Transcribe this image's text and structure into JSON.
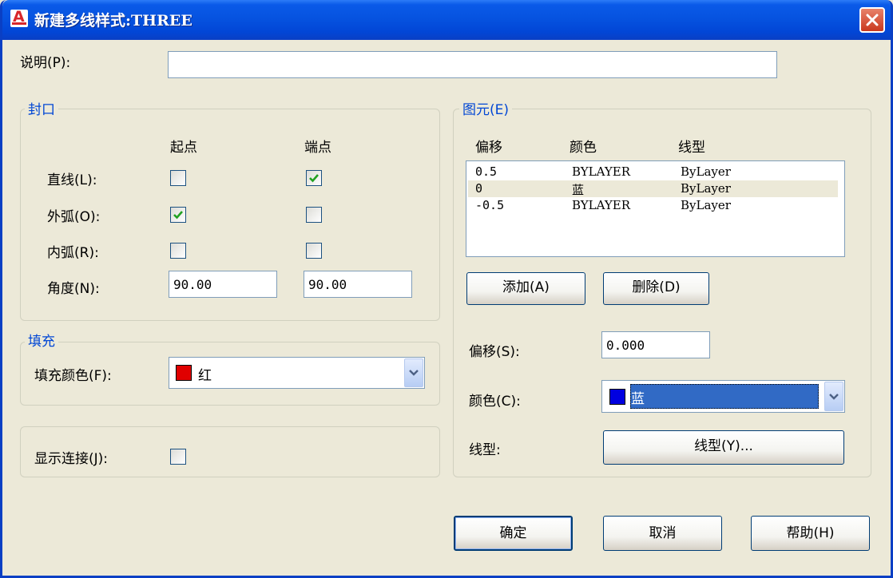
{
  "window": {
    "title": "新建多线样式:THREE"
  },
  "description": {
    "label": "说明(P):",
    "value": ""
  },
  "caps": {
    "title": "封口",
    "col_start": "起点",
    "col_end": "端点",
    "line_label": "直线(L):",
    "outer_arc_label": "外弧(O):",
    "inner_arc_label": "内弧(R):",
    "angle_label": "角度(N):",
    "line_start_checked": false,
    "line_end_checked": true,
    "outer_arc_start_checked": true,
    "outer_arc_end_checked": false,
    "inner_arc_start_checked": false,
    "inner_arc_end_checked": false,
    "angle_start": "90.00",
    "angle_end": "90.00"
  },
  "fill": {
    "title": "填充",
    "color_label": "填充颜色(F):",
    "color_value": "红",
    "swatch_color": "#e00000"
  },
  "joints": {
    "label": "显示连接(J):",
    "checked": false
  },
  "elements": {
    "title": "图元(E)",
    "columns": [
      "偏移",
      "颜色",
      "线型"
    ],
    "rows": [
      {
        "offset": "0.5",
        "color": "BYLAYER",
        "linetype": "ByLayer",
        "selected": false
      },
      {
        "offset": "0",
        "color": "蓝",
        "linetype": "ByLayer",
        "selected": true
      },
      {
        "offset": "-0.5",
        "color": "BYLAYER",
        "linetype": "ByLayer",
        "selected": false
      }
    ],
    "add_label": "添加(A)",
    "delete_label": "删除(D)",
    "offset_label": "偏移(S):",
    "offset_value": "0.000",
    "color_label": "颜色(C):",
    "color_value": "蓝",
    "color_swatch": "#0000e0",
    "linetype_label": "线型:",
    "linetype_button": "线型(Y)..."
  },
  "buttons": {
    "ok": "确定",
    "cancel": "取消",
    "help": "帮助(H)"
  },
  "colors": {
    "title_bar": "#0653e0",
    "group_title": "#0046d5",
    "selection": "#316ac5"
  }
}
